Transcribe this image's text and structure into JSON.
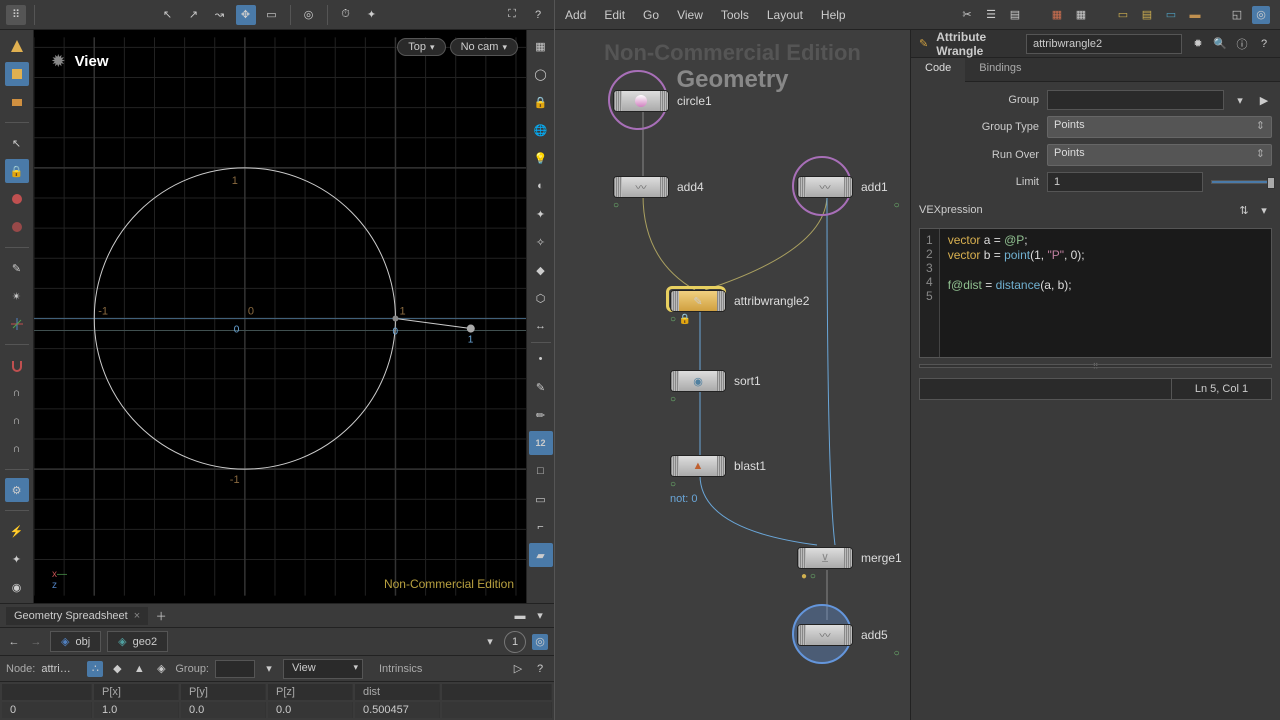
{
  "viewport": {
    "label": "View",
    "cam_top": "Top",
    "cam_nocam": "No cam",
    "watermark": "Non-Commercial Edition",
    "axis_labels": {
      "x": "x",
      "z": "z"
    },
    "grid_labels": {
      "neg1": "-1",
      "zero": "0",
      "one": "1"
    },
    "point_labels": {
      "p0": "0",
      "p1": "1"
    }
  },
  "spreadsheet": {
    "tab": "Geometry Spreadsheet",
    "path": {
      "obj": "obj",
      "geo": "geo2"
    },
    "node_label": "Node:",
    "node_value": "attri…",
    "group_label": "Group:",
    "view_dd": "View",
    "intrinsics": "Intrinsics",
    "columns": [
      "",
      "P[x]",
      "P[y]",
      "P[z]",
      "dist"
    ],
    "rows": [
      [
        "0",
        "1.0",
        "0.0",
        "0.0",
        "0.500457"
      ]
    ]
  },
  "menu": {
    "items": [
      "Add",
      "Edit",
      "Go",
      "View",
      "Tools",
      "Layout",
      "Help"
    ]
  },
  "network": {
    "bg": "Non-Commercial Edition",
    "bg2": "Geometry",
    "nodes": {
      "circle1": "circle1",
      "add4": "add4",
      "add1": "add1",
      "attribwrangle2": "attribwrangle2",
      "sort1": "sort1",
      "blast1": "blast1",
      "blast1_info": "not: 0",
      "merge1": "merge1",
      "add5": "add5"
    }
  },
  "params": {
    "title": "Attribute Wrangle",
    "name": "attribwrangle2",
    "tabs": {
      "code": "Code",
      "bindings": "Bindings"
    },
    "group_label": "Group",
    "group_value": "",
    "grouptype_label": "Group Type",
    "grouptype_value": "Points",
    "runover_label": "Run Over",
    "runover_value": "Points",
    "limit_label": "Limit",
    "limit_value": "1",
    "vex_label": "VEXpression",
    "code": {
      "l1": {
        "kw": "vector",
        "var": " a = ",
        "at": "@P",
        "end": ";"
      },
      "l2": {
        "kw": "vector",
        "var": " b = ",
        "fn": "point",
        "args": "(1, ",
        "str": "\"P\"",
        "args2": ", 0);"
      },
      "l4": {
        "at": "f@dist",
        "var": " = ",
        "fn": "distance",
        "args": "(a, b);"
      }
    },
    "cursor": "Ln 5, Col 1"
  }
}
